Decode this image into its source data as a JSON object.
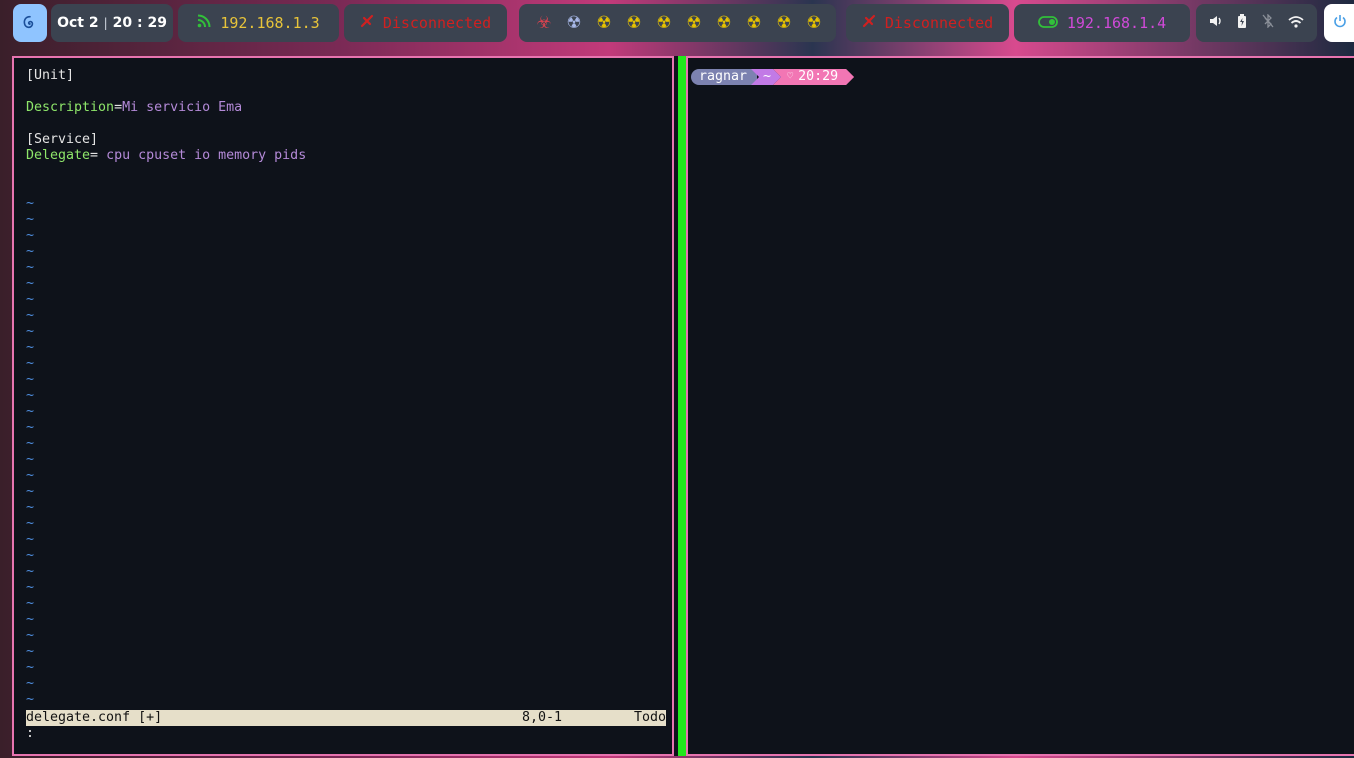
{
  "topbar": {
    "clock": {
      "date": "Oct 2",
      "time": "20 : 29"
    },
    "network_left": {
      "icon": "rss-icon",
      "ip": "192.168.1.3"
    },
    "vpn_left": {
      "icon": "unplug-icon",
      "status": "Disconnected"
    },
    "status_icons": [
      "biohazard-icon",
      "radiation-icon",
      "radiation-icon",
      "radiation-icon",
      "radiation-icon",
      "radiation-icon",
      "radiation-icon",
      "radiation-icon",
      "radiation-icon",
      "radiation-icon"
    ],
    "vpn_right": {
      "icon": "unplug-icon",
      "status": "Disconnected"
    },
    "network_right": {
      "icon": "toggle-on-icon",
      "ip": "192.168.1.4"
    },
    "tray": [
      "volume-icon",
      "battery-icon",
      "bluetooth-off-icon",
      "wifi-icon"
    ],
    "colors": {
      "accent_pink": "#e874b0",
      "divider_green": "#22e81c",
      "disconnected_red": "#d02020",
      "ip_yellow": "#e8c43a",
      "ip_magenta": "#d04ad8"
    }
  },
  "vim": {
    "lines": [
      {
        "plain": "[Unit]"
      },
      {
        "plain": ""
      },
      {
        "key": "Description",
        "eq": "=",
        "value": "Mi servicio Ema"
      },
      {
        "plain": ""
      },
      {
        "plain": "[Service]"
      },
      {
        "key": "Delegate",
        "eq": "= ",
        "value": "cpu cpuset io memory pids"
      },
      {
        "plain": ""
      },
      {
        "plain": ""
      }
    ],
    "tilde_char": "~",
    "tilde_count": 32,
    "status": {
      "filename": "delegate.conf [+]",
      "position": "8,0-1",
      "percent": "Todo"
    },
    "cmdline": ":"
  },
  "shell": {
    "prompt": {
      "user": "ragnar",
      "dir": "~",
      "heart": "♡",
      "time": "20:29"
    }
  }
}
